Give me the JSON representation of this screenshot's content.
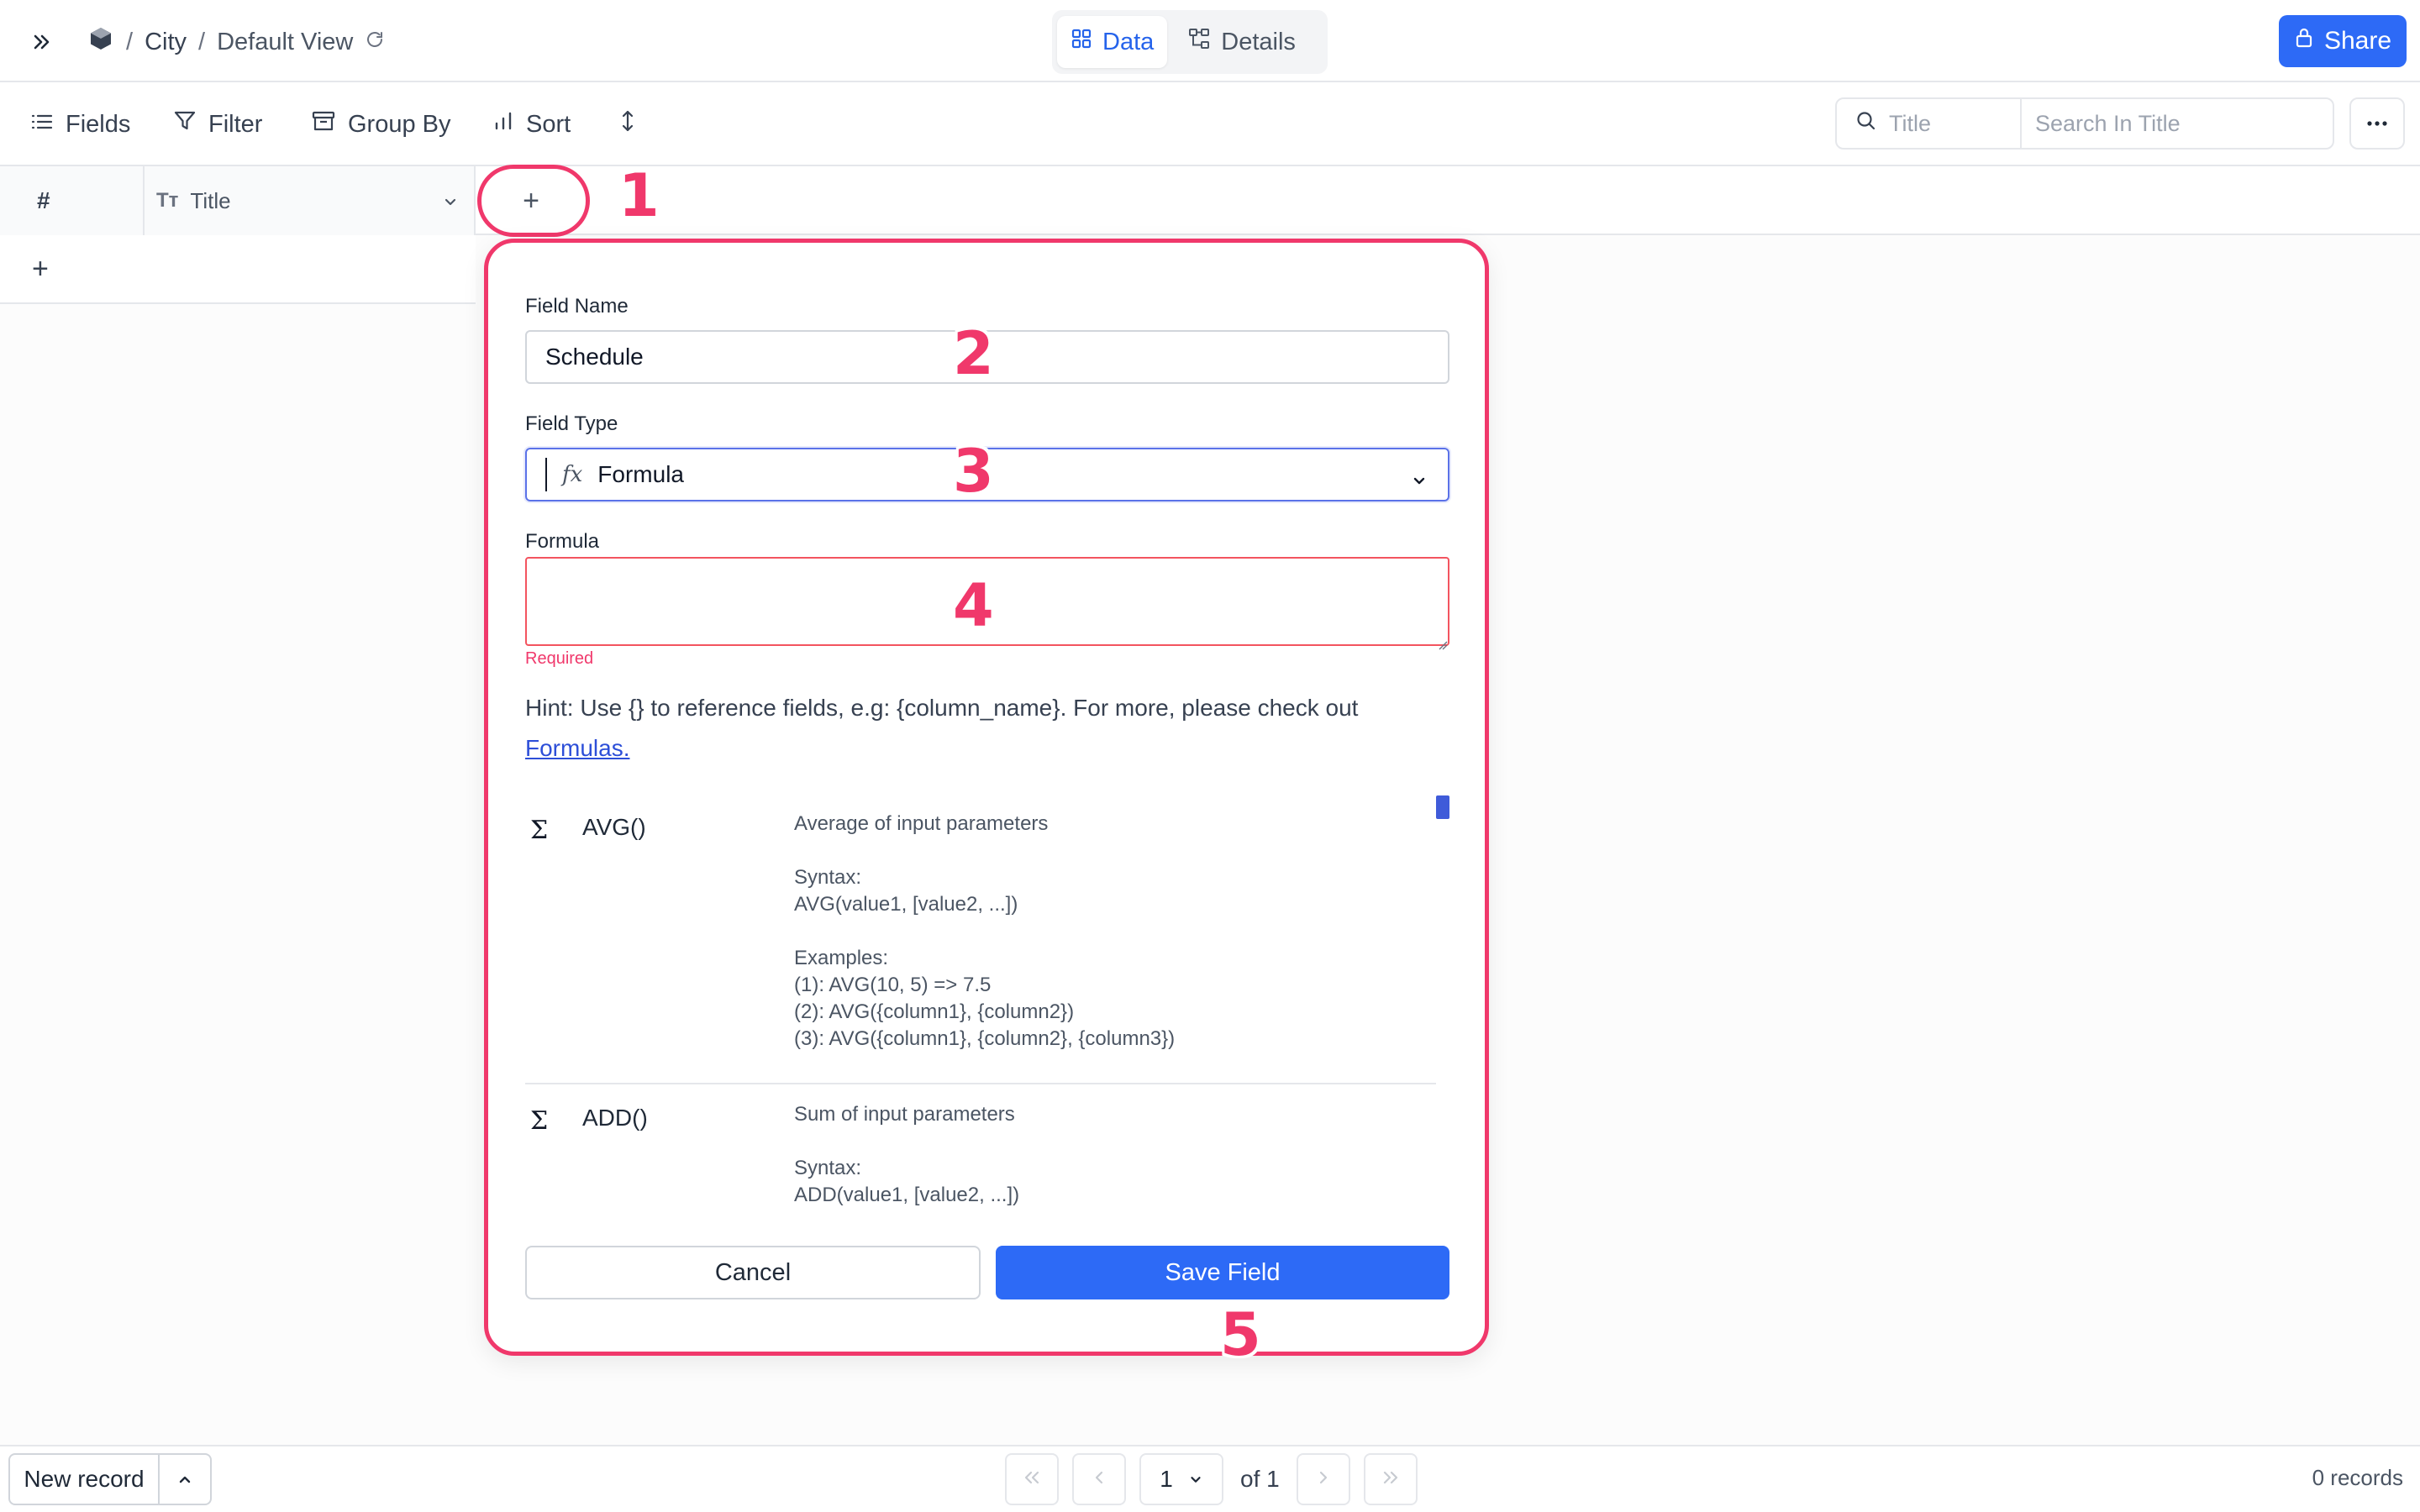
{
  "header": {
    "breadcrumb": {
      "separator": "/",
      "table": "City",
      "view": "Default View"
    },
    "tabs": [
      {
        "label": "Data",
        "active": true,
        "icon": "grid-icon"
      },
      {
        "label": "Details",
        "active": false,
        "icon": "tree-icon"
      }
    ],
    "share_label": "Share"
  },
  "toolbar": {
    "fields_label": "Fields",
    "filter_label": "Filter",
    "group_label": "Group By",
    "sort_label": "Sort",
    "search_field": "Title",
    "search_placeholder": "Search In Title"
  },
  "grid": {
    "columns": [
      {
        "label": "#"
      },
      {
        "label": "Title",
        "type_icon": "Tт"
      }
    ],
    "add_column_symbol": "+",
    "add_row_symbol": "+"
  },
  "form": {
    "field_name_label": "Field Name",
    "field_name_value": "Schedule",
    "field_type_label": "Field Type",
    "field_type_icon": "𝑓x",
    "field_type_value": "Formula",
    "formula_label": "Formula",
    "formula_value": "",
    "required_text": "Required",
    "hint_text": "Hint: Use {} to reference fields, e.g: {column_name}. For more, please check out",
    "hint_link": "Formulas.",
    "functions": [
      {
        "symbol": "Σ",
        "name": "AVG()",
        "description": "Average of input parameters\n\nSyntax:\nAVG(value1, [value2, ...])\n\nExamples:\n(1): AVG(10, 5) => 7.5\n(2): AVG({column1}, {column2})\n(3): AVG({column1}, {column2}, {column3})"
      },
      {
        "symbol": "Σ",
        "name": "ADD()",
        "description": "Sum of input parameters\n\nSyntax:\nADD(value1, [value2, ...])"
      }
    ],
    "cancel_label": "Cancel",
    "save_label": "Save Field"
  },
  "annotations": [
    "1",
    "2",
    "3",
    "4",
    "5"
  ],
  "footer": {
    "new_record_label": "New record",
    "page_current": "1",
    "page_of": "of 1",
    "records_count": "0 records"
  },
  "colors": {
    "accent": "#2d6af6",
    "annotation": "#f0386b",
    "error": "#f3545f"
  }
}
